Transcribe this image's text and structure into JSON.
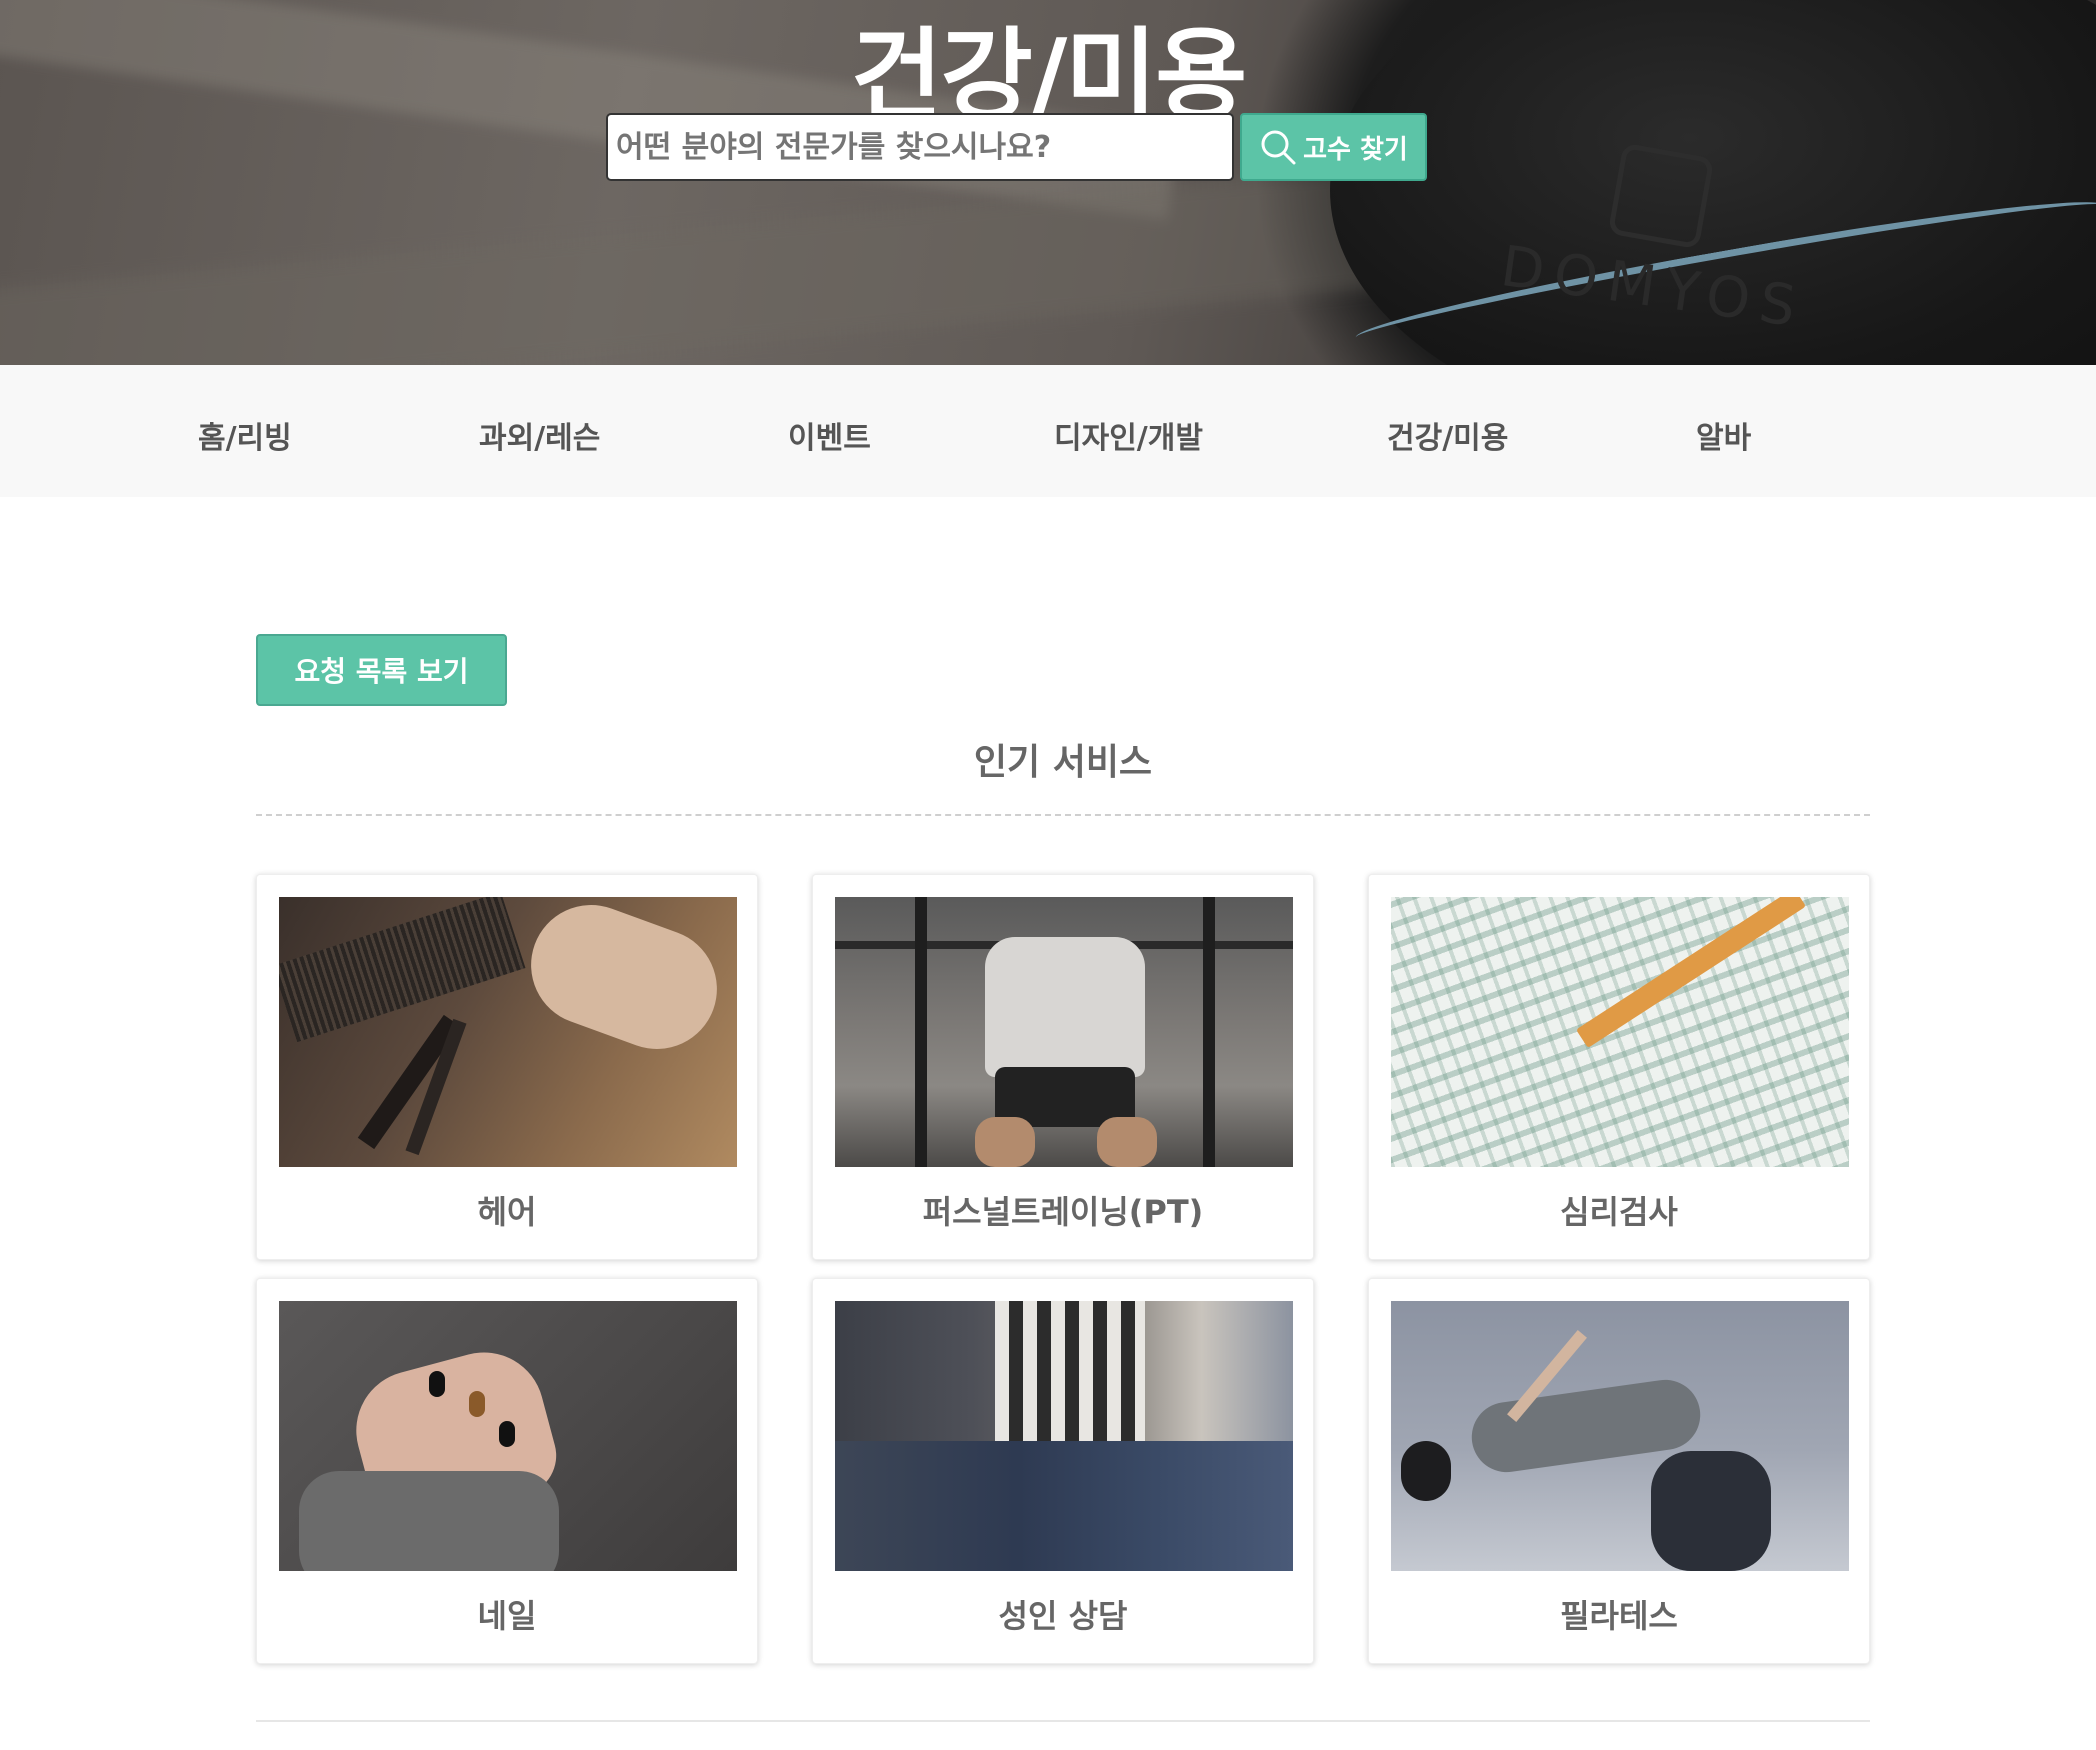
{
  "hero": {
    "title": "건강/미용",
    "search_placeholder": "어떤 분야의 전문가를 찾으시나요?",
    "search_button": "고수 찾기"
  },
  "nav": {
    "items": [
      {
        "label": "홈/리빙"
      },
      {
        "label": "과외/레슨"
      },
      {
        "label": "이벤트"
      },
      {
        "label": "디자인/개발"
      },
      {
        "label": "건강/미용"
      },
      {
        "label": "알바"
      }
    ]
  },
  "content": {
    "request_button": "요청 목록 보기",
    "section_title": "인기 서비스",
    "services": [
      {
        "label": "헤어",
        "icon": "scissors-hair-photo"
      },
      {
        "label": "퍼스널트레이닝(PT)",
        "icon": "barbell-photo"
      },
      {
        "label": "심리검사",
        "icon": "test-sheet-photo"
      },
      {
        "label": "네일",
        "icon": "nail-photo"
      },
      {
        "label": "성인 상담",
        "icon": "people-photo"
      },
      {
        "label": "필라테스",
        "icon": "pilates-photo"
      }
    ]
  },
  "colors": {
    "accent": "#5cc4a7",
    "nav_bg": "#f8f8f8",
    "text": "#666666"
  }
}
